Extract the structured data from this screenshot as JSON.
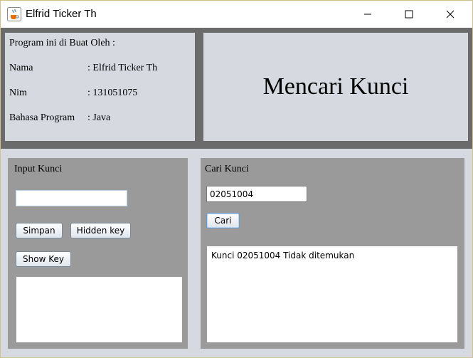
{
  "window": {
    "title": "Elfrid Ticker Th",
    "icon": "java-cup-icon",
    "controls": [
      "minimize-icon",
      "maximize-icon",
      "close-icon"
    ]
  },
  "info": {
    "heading": "Program ini di Buat Oleh :",
    "rows": [
      {
        "label": "Nama",
        "value": ": Elfrid Ticker Th"
      },
      {
        "label": "Nim",
        "value": ": 131051075"
      },
      {
        "label": "Bahasa Program",
        "value": ": Java"
      }
    ]
  },
  "banner": {
    "title": "Mencari Kunci"
  },
  "input_panel": {
    "label": "Input Kunci",
    "field_value": "",
    "simpan_label": "Simpan",
    "hidden_key_label": "Hidden key",
    "show_key_label": "Show Key",
    "output_text": ""
  },
  "search_panel": {
    "label": "Cari Kunci",
    "field_value": "02051004",
    "cari_label": "Cari",
    "result_text": "Kunci 02051004 Tidak ditemukan"
  },
  "colors": {
    "frame_dark": "#6b6b6b",
    "panel_light": "#d6d9e0",
    "panel_gray": "#9a9a9a",
    "button_focus_border": "#6a9bd1"
  }
}
